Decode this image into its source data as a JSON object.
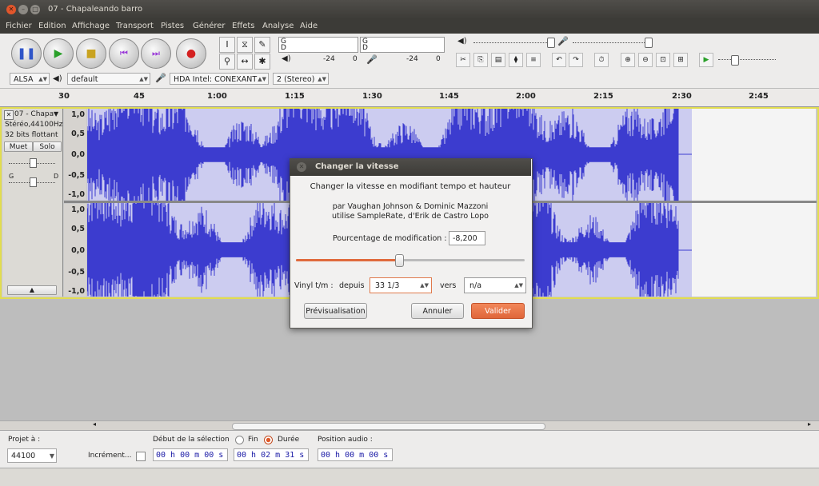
{
  "window": {
    "title": "07 - Chapaleando barro"
  },
  "menu": [
    "Fichier",
    "Edition",
    "Affichage",
    "Transport",
    "Pistes",
    "Générer",
    "Effets",
    "Analyse",
    "Aide"
  ],
  "meters": {
    "rec_label": "G",
    "play_label": "G",
    "d_label": "D",
    "scale_a": "-24",
    "scale_b": "0",
    "scale_c": "-24",
    "scale_d": "0"
  },
  "device": {
    "host": "ALSA",
    "output": "default",
    "input": "HDA Intel: CONEXANT",
    "channels": "2 (Stereo)"
  },
  "ruler": {
    "ticks": [
      "30",
      "45",
      "1:00",
      "1:15",
      "1:30",
      "1:45",
      "2:00",
      "2:15",
      "2:30",
      "2:45"
    ]
  },
  "track": {
    "name": "07 - Chapa",
    "format": "Stéréo,44100Hz",
    "bits": "32 bits flottant",
    "mute_label": "Muet",
    "solo_label": "Solo",
    "pan_left": "G",
    "pan_right": "D",
    "scale_top": [
      "1,0",
      "0,5",
      "0,0",
      "-0,5",
      "-1,0"
    ],
    "scale_bottom": [
      "1,0",
      "0,5",
      "0,0",
      "-0,5",
      "-1,0"
    ]
  },
  "dialog": {
    "title": "Changer la vitesse",
    "heading": "Changer la vitesse en modifiant tempo et hauteur",
    "credit_line1": "par Vaughan Johnson & Dominic Mazzoni",
    "credit_line2": "utilise SampleRate, d'Erik de Castro Lopo",
    "percent_label": "Pourcentage de modification :",
    "percent_value": "-8,200",
    "slider_fraction": 0.45,
    "vinyl_label": "Vinyl t/m :",
    "from_label": "depuis",
    "from_value": "33 1/3",
    "to_label": "vers",
    "to_value": "n/a",
    "preview_button": "Prévisualisation",
    "cancel_button": "Annuler",
    "ok_button": "Valider"
  },
  "selection": {
    "project_label": "Projet à :",
    "project_rate": "44100",
    "snap_label": "Incrément...",
    "start_label": "Début de la sélection",
    "end_option": "Fin",
    "length_option": "Durée",
    "audio_pos_label": "Position audio :",
    "start_time": "00 h 00 m 00 s",
    "length_time": "00 h 02 m 31 s",
    "audio_time": "00 h 00 m 00 s"
  }
}
